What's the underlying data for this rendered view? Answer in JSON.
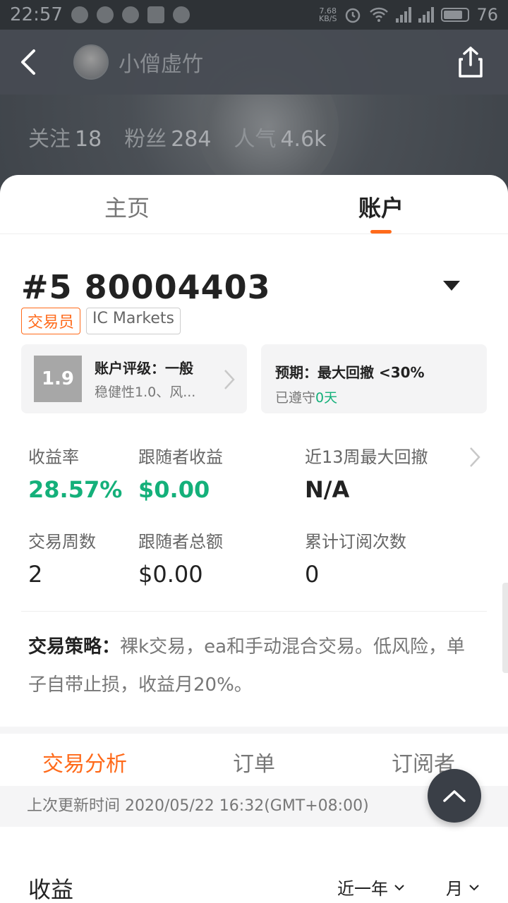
{
  "status_bar": {
    "time": "22:57",
    "net_speed_value": "7.68",
    "net_speed_unit": "KB/S",
    "battery": "76"
  },
  "header": {
    "user_name": "小僧虚竹",
    "stats": [
      {
        "label": "关注",
        "value": "18"
      },
      {
        "label": "粉丝",
        "value": "284"
      },
      {
        "label": "人气",
        "value": "4.6k"
      }
    ]
  },
  "top_tabs": [
    {
      "label": "主页"
    },
    {
      "label": "账户"
    }
  ],
  "account": {
    "id": "#5 80004403",
    "badge_role": "交易员",
    "badge_broker": "IC Markets"
  },
  "rating": {
    "score": "1.9",
    "title": "账户评级：一般",
    "subtitle": "稳健性1.0、风..."
  },
  "expectation": {
    "title": "预期：最大回撤 <30%",
    "sub_prefix": "已遵守",
    "sub_value": "0天"
  },
  "metrics": [
    {
      "label": "收益率",
      "value": "28.57%"
    },
    {
      "label": "跟随者收益",
      "value": "$0.00"
    },
    {
      "label": "近13周最大回撤",
      "value": "N/A"
    },
    {
      "label": "交易周数",
      "value": "2"
    },
    {
      "label": "跟随者总额",
      "value": "$0.00"
    },
    {
      "label": "累计订阅次数",
      "value": "0"
    }
  ],
  "strategy": {
    "label": "交易策略：",
    "text": "裸k交易，ea和手动混合交易。低风险，单子自带止损，收益月20%。"
  },
  "bottom_tabs": [
    {
      "label": "交易分析"
    },
    {
      "label": "订单"
    },
    {
      "label": "订阅者"
    }
  ],
  "updated": "上次更新时间 2020/05/22 16:32(GMT+08:00)",
  "income": {
    "title": "收益",
    "range": "近一年",
    "unit": "月"
  },
  "colors": {
    "accent": "#ff6a1a",
    "positive": "#14b07a"
  }
}
